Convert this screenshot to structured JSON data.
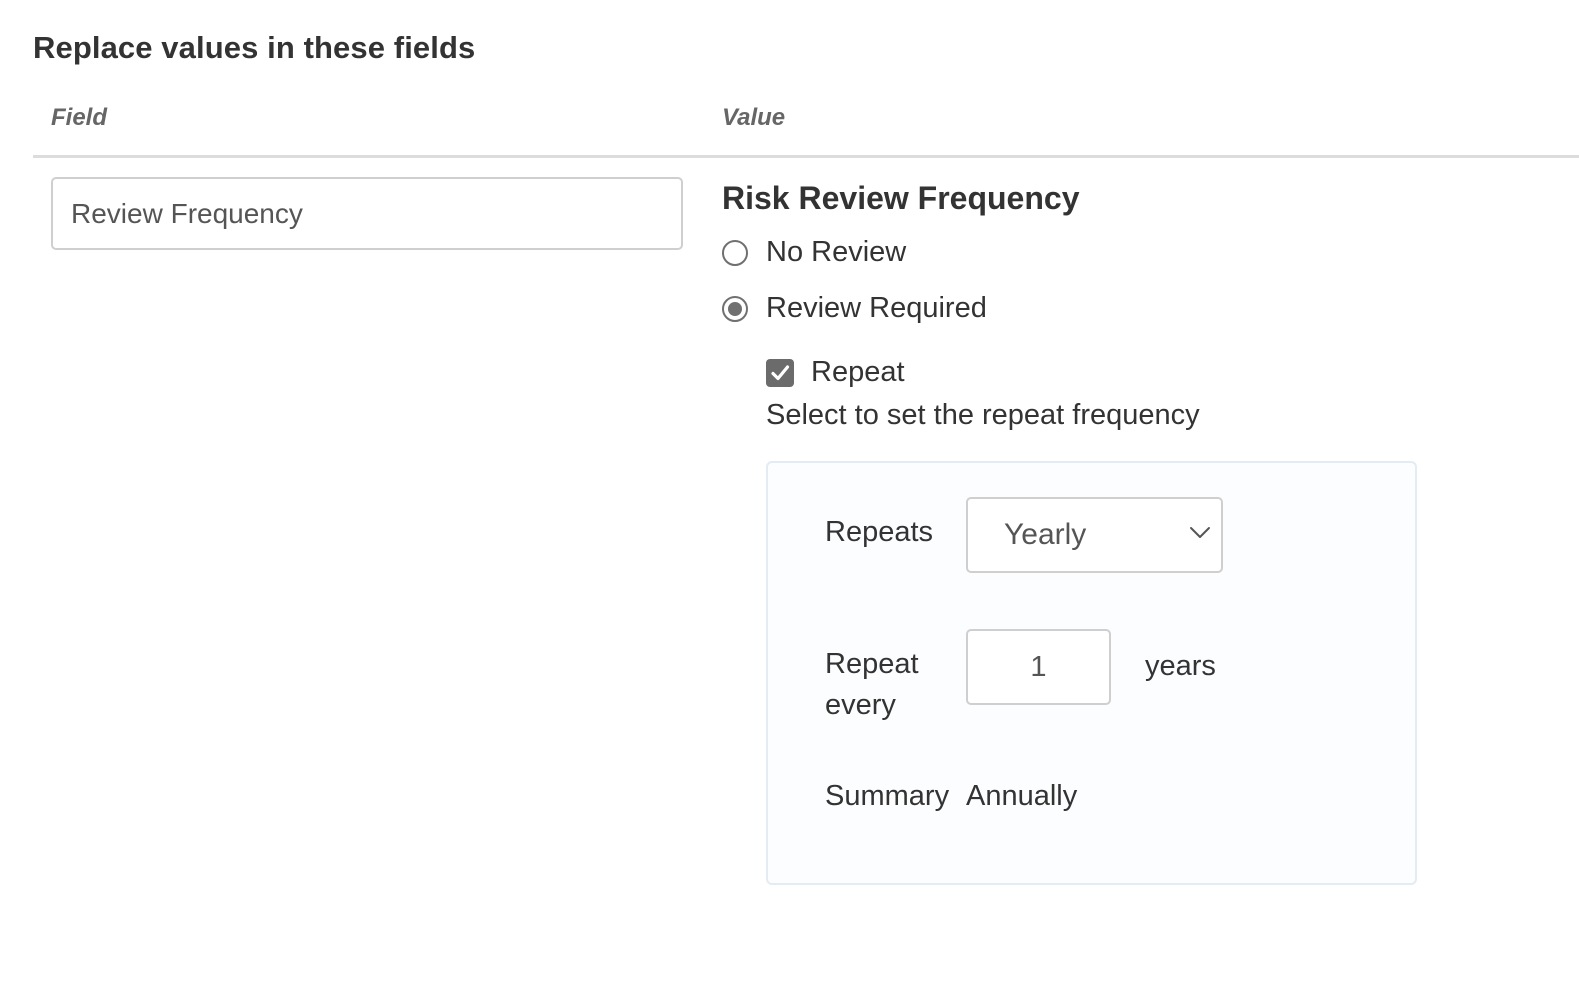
{
  "section_title": "Replace values in these fields",
  "columns": {
    "field": "Field",
    "value": "Value"
  },
  "field": {
    "value": "Review Frequency"
  },
  "value_section": {
    "title": "Risk Review Frequency",
    "options": [
      {
        "label": "No Review",
        "selected": false
      },
      {
        "label": "Review Required",
        "selected": true
      }
    ],
    "repeat": {
      "label": "Repeat",
      "checked": true,
      "help_text": "Select to set the repeat frequency",
      "panel": {
        "repeats_label": "Repeats",
        "repeats_value": "Yearly",
        "repeat_every_label": "Repeat every",
        "repeat_every_value": "1",
        "unit": "years",
        "summary_label": "Summary",
        "summary_value": "Annually"
      }
    }
  },
  "icons": {
    "checkbox": "checkmark-icon",
    "select": "chevron-down-icon"
  },
  "colors": {
    "checkbox_fill": "#6b6b6b",
    "radio_fill": "#707070",
    "panel_border": "#e3ebf3"
  }
}
